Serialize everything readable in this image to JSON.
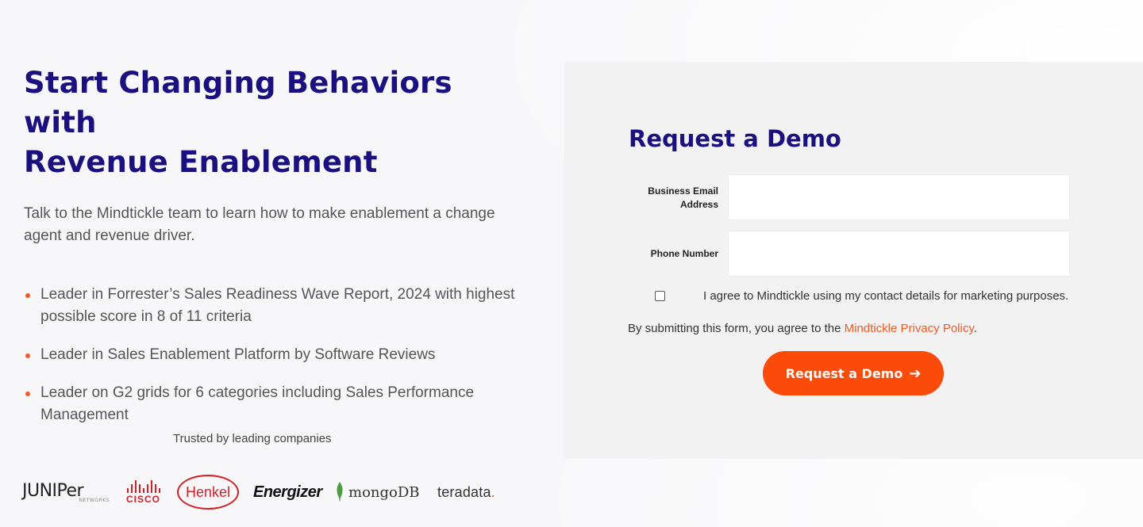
{
  "hero": {
    "headline_line1": "Start Changing Behaviors with",
    "headline_line2": "Revenue Enablement",
    "subtitle": "Talk to the Mindtickle team to learn how to make enablement a change agent and revenue driver.",
    "bullets": [
      "Leader in Forrester’s Sales Readiness Wave Report, 2024 with highest possible score in 8 of 11 criteria",
      "Leader in Sales Enablement Platform by Software Reviews",
      "Leader on G2 grids for 6 categories including Sales Performance Management"
    ]
  },
  "trusted": {
    "label": "Trusted by leading companies",
    "logos": {
      "juniper": "JUNIPer",
      "juniper_sub": "NETWORKS",
      "cisco": "CISCO",
      "henkel": "Henkel",
      "energizer": "Energizer",
      "mongodb": "mongoDB",
      "teradata": "teradata"
    }
  },
  "form": {
    "title": "Request a Demo",
    "email_label_line1": "Business Email",
    "email_label_line2": "Address",
    "email_value": "",
    "phone_label": "Phone Number",
    "phone_value": "",
    "consent_text": "I agree to Mindtickle using my contact details for marketing purposes.",
    "note_prefix": "By submitting this form, you agree to the ",
    "note_link": "Mindtickle Privacy Policy",
    "note_suffix": ".",
    "submit_label": "Request a Demo"
  },
  "colors": {
    "heading": "#1a1080",
    "accent": "#fb4b0a",
    "link": "#f05a22",
    "panel_bg": "#f3f2f3"
  }
}
